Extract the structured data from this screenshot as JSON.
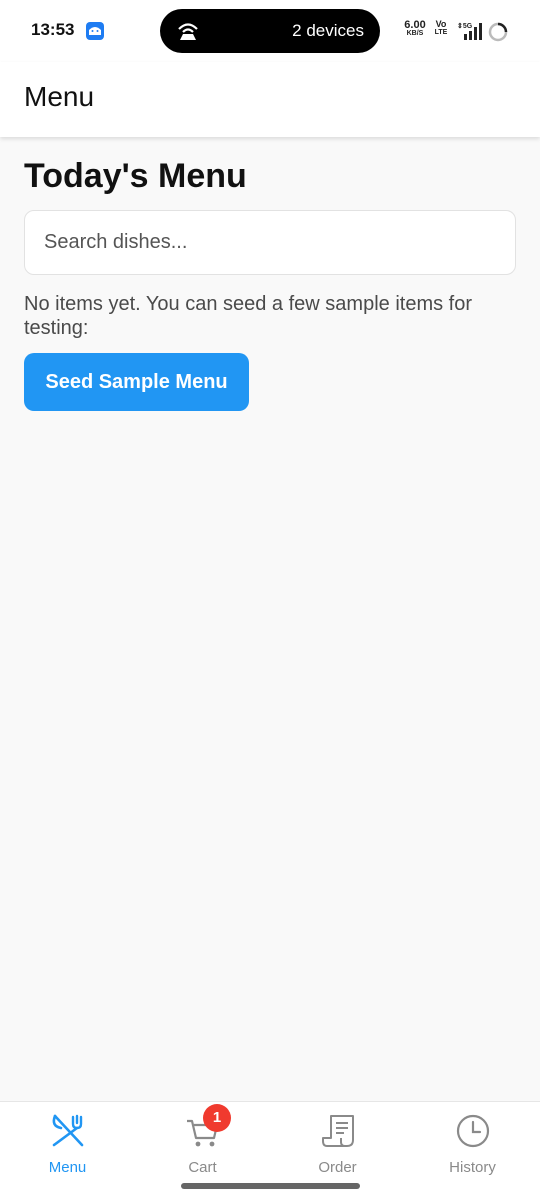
{
  "status_bar": {
    "time": "13:53",
    "hotspot_text": "2 devices",
    "net_speed": "6.00",
    "net_speed_unit": "KB/S",
    "volte_top": "Vo",
    "volte_bottom": "LTE",
    "network": "5G"
  },
  "app_bar": {
    "title": "Menu"
  },
  "main": {
    "heading": "Today's Menu",
    "search_placeholder": "Search dishes...",
    "empty_message": "No items yet. You can seed a few sample items for testing:",
    "seed_button_label": "Seed Sample Menu"
  },
  "bottom_nav": {
    "items": [
      {
        "label": "Menu",
        "icon": "fork-knife-icon",
        "active": true
      },
      {
        "label": "Cart",
        "icon": "cart-icon",
        "badge": "1"
      },
      {
        "label": "Order",
        "icon": "receipt-icon"
      },
      {
        "label": "History",
        "icon": "clock-icon"
      }
    ]
  },
  "colors": {
    "accent": "#2196f3",
    "badge": "#f03a2e",
    "background": "#f9f9f9"
  }
}
